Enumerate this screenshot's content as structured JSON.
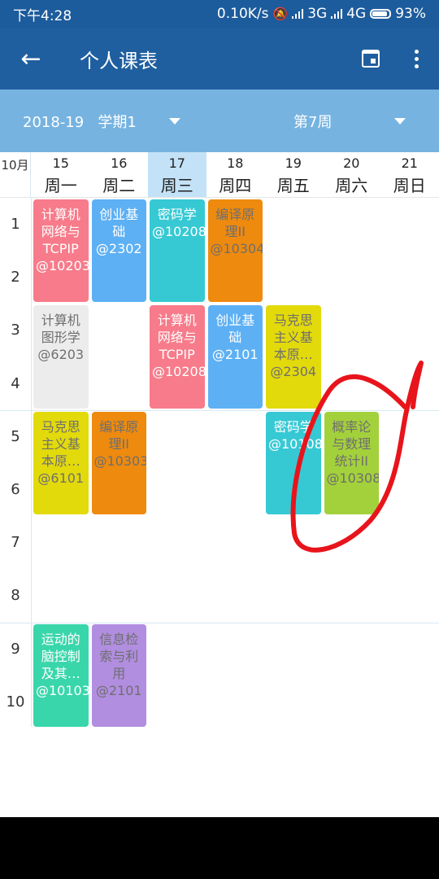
{
  "status_bar": {
    "time": "下午4:28",
    "net_speed": "0.10K/s",
    "network1": "3G",
    "network2": "4G",
    "battery": "93%"
  },
  "app_bar": {
    "title": "个人课表",
    "back_icon": "arrow-left-icon",
    "calendar_icon": "calendar-icon",
    "menu_icon": "more-vert-icon"
  },
  "selector": {
    "term": "2018-19   学期1",
    "week": "第7周"
  },
  "header": {
    "month": "10月",
    "days": [
      {
        "num": "15",
        "week": "周一"
      },
      {
        "num": "16",
        "week": "周二"
      },
      {
        "num": "17",
        "week": "周三"
      },
      {
        "num": "18",
        "week": "周四"
      },
      {
        "num": "19",
        "week": "周五"
      },
      {
        "num": "20",
        "week": "周六"
      },
      {
        "num": "21",
        "week": "周日"
      }
    ],
    "today_index": 2
  },
  "periods": [
    "1",
    "2",
    "3",
    "4",
    "5",
    "6",
    "7",
    "8",
    "9",
    "10"
  ],
  "courses": [
    {
      "name": "计算机网络与TCPIP",
      "room": "@10203",
      "day": 0,
      "start": 1,
      "end": 2,
      "color": "#f77b8a",
      "dark_text": false
    },
    {
      "name": "创业基础",
      "room": "@2302",
      "day": 1,
      "start": 1,
      "end": 2,
      "color": "#5db0f4",
      "dark_text": false
    },
    {
      "name": "密码学",
      "room": "@10208",
      "day": 2,
      "start": 1,
      "end": 2,
      "color": "#36c9d4",
      "dark_text": false
    },
    {
      "name": "编译原理II",
      "room": "@10304",
      "day": 3,
      "start": 1,
      "end": 2,
      "color": "#ee8a0e",
      "dark_text": true
    },
    {
      "name": "计算机图形学",
      "room": "@6203",
      "day": 0,
      "start": 3,
      "end": 4,
      "color": "#ececec",
      "dark_text": true
    },
    {
      "name": "计算机网络与TCPIP",
      "room": "@10208",
      "day": 2,
      "start": 3,
      "end": 4,
      "color": "#f77b8a",
      "dark_text": false
    },
    {
      "name": "创业基础",
      "room": "@2101",
      "day": 3,
      "start": 3,
      "end": 4,
      "color": "#5db0f4",
      "dark_text": false
    },
    {
      "name": "马克思主义基本原…",
      "room": "@2304",
      "day": 4,
      "start": 3,
      "end": 4,
      "color": "#e3da0b",
      "dark_text": true
    },
    {
      "name": "马克思主义基本原…",
      "room": "@6101",
      "day": 0,
      "start": 5,
      "end": 6,
      "color": "#e3da0b",
      "dark_text": true
    },
    {
      "name": "编译原理II",
      "room": "@10303",
      "day": 1,
      "start": 5,
      "end": 6,
      "color": "#ee8a0e",
      "dark_text": true
    },
    {
      "name": "密码学",
      "room": "@10108",
      "day": 4,
      "start": 5,
      "end": 6,
      "color": "#36c9d4",
      "dark_text": false
    },
    {
      "name": "概率论与数理统计II",
      "room": "@10308",
      "day": 5,
      "start": 5,
      "end": 6,
      "color": "#a3d13b",
      "dark_text": true
    },
    {
      "name": "运动的脑控制及其…",
      "room": "@10103",
      "day": 0,
      "start": 9,
      "end": 10,
      "color": "#3ad6ab",
      "dark_text": false
    },
    {
      "name": "信息检索与利用",
      "room": "@2101",
      "day": 1,
      "start": 9,
      "end": 10,
      "color": "#b18ee0",
      "dark_text": true
    }
  ]
}
